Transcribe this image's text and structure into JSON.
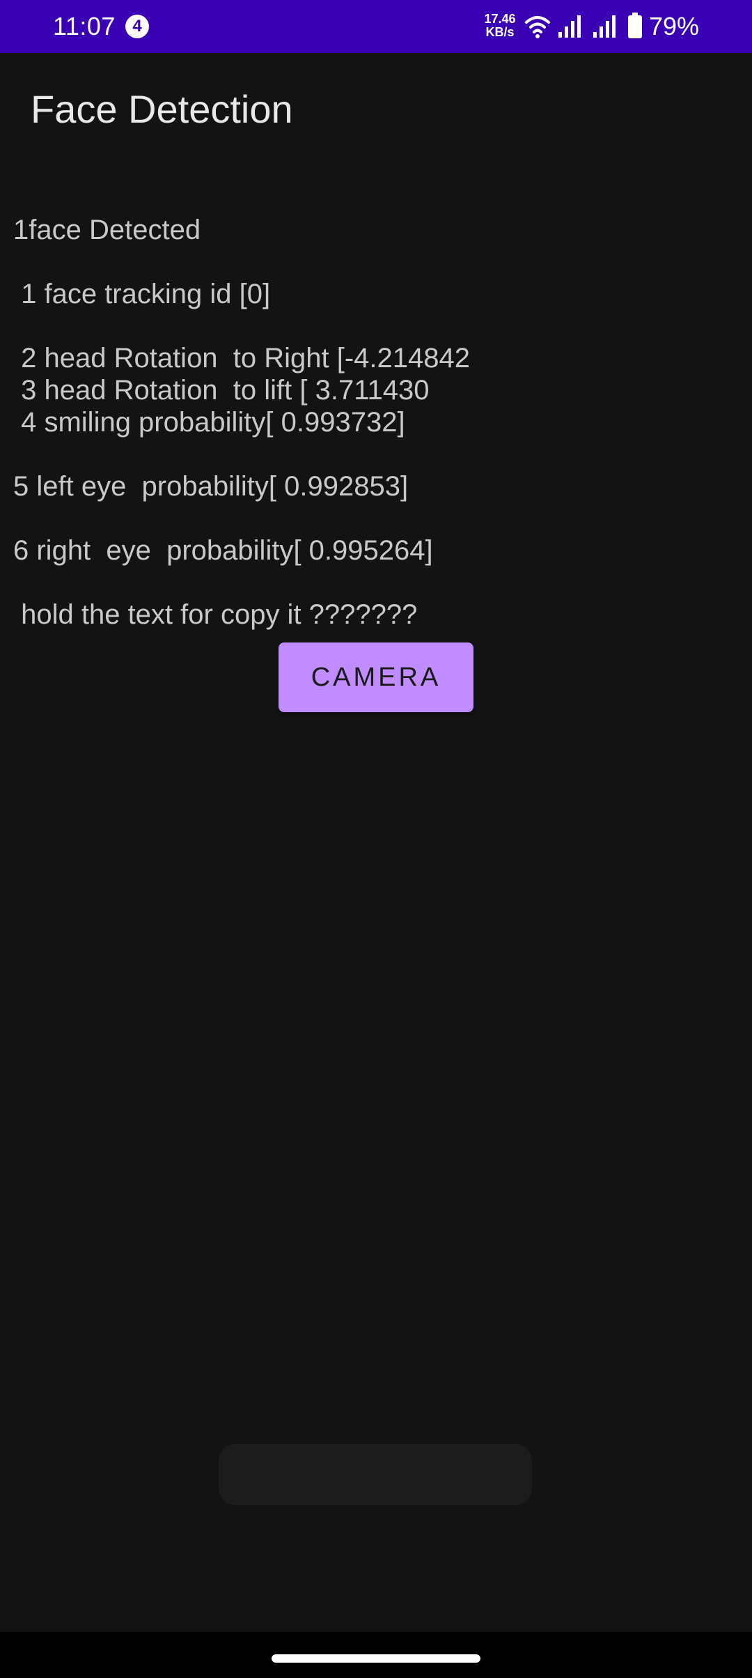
{
  "status_bar": {
    "time": "11:07",
    "notification_count": "4",
    "net_speed_value": "17.46",
    "net_speed_unit": "KB/s",
    "battery_percent": "79%",
    "icons": [
      "wifi-icon",
      "signal-icon",
      "signal-icon",
      "battery-icon"
    ]
  },
  "app_bar": {
    "title": "Face Detection"
  },
  "results": {
    "summary": "1face Detected",
    "tracking_id": " 1 face tracking id [0]",
    "head_rotation_right": " 2 head Rotation  to Right [-4.214842",
    "head_rotation_lift": " 3 head Rotation  to lift [ 3.711430",
    "smiling_probability": " 4 smiling probability[ 0.993732]",
    "left_eye_probability": "5 left eye  probability[ 0.992853]",
    "right_eye_probability": "6 right  eye  probability[ 0.995264]",
    "copy_hint": " hold the text for copy it ???????"
  },
  "actions": {
    "camera_label": "CAMERA"
  },
  "colors": {
    "status_bar_bg": "#3a00b3",
    "background": "#131313",
    "button_bg": "#c08cff",
    "text": "#c9c9c9"
  }
}
